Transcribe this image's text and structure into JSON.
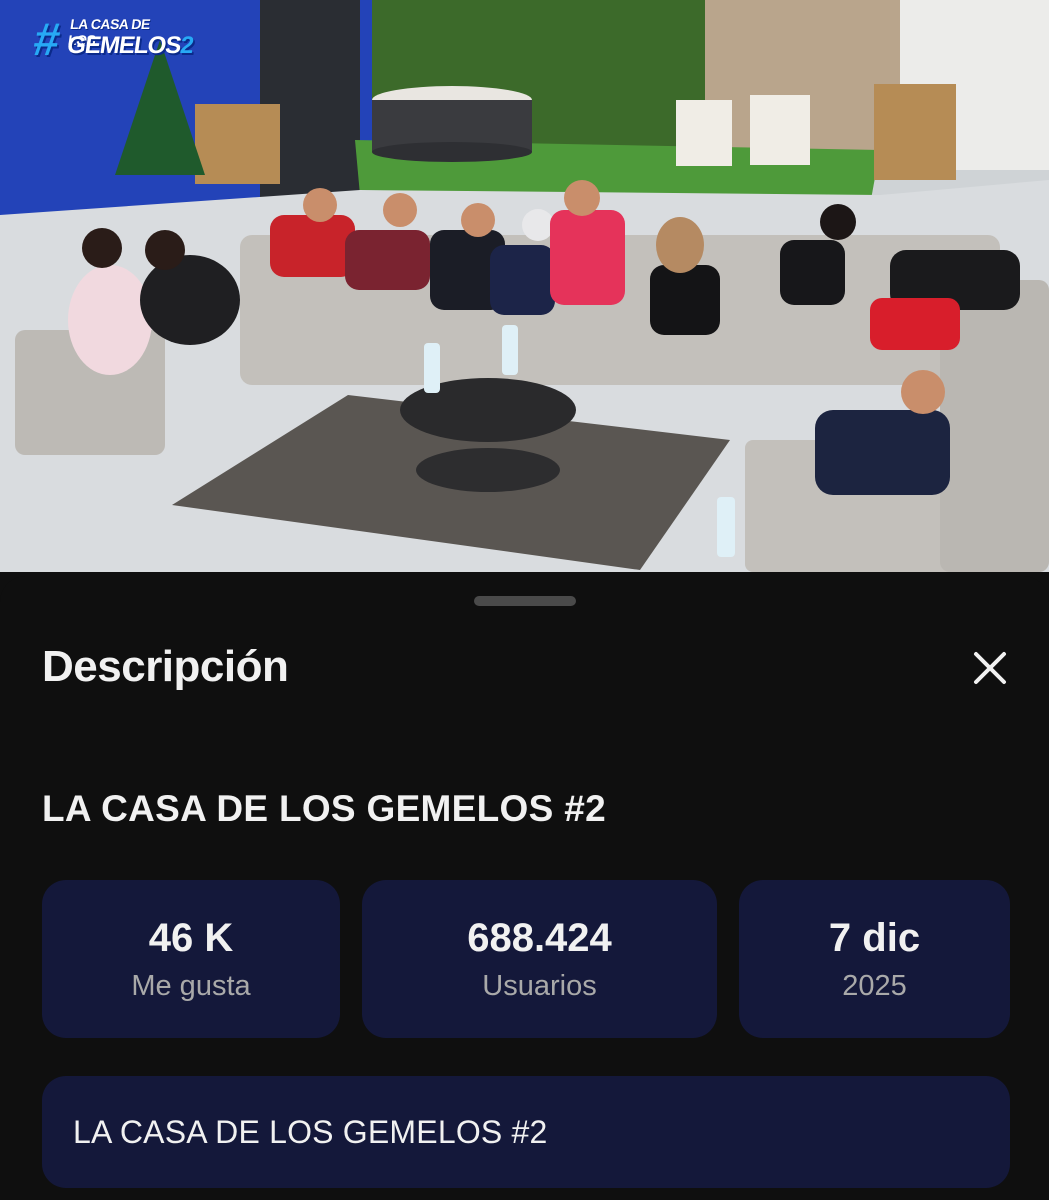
{
  "video": {
    "logo_line1": "LA CASA DE LOS",
    "logo_line2": "GEMELOS",
    "logo_hash": "#",
    "logo_number": "2"
  },
  "sheet": {
    "title": "Descripción",
    "close_icon": "close-icon",
    "video_title": "LA CASA DE LOS GEMELOS #2",
    "stats": {
      "likes": {
        "value": "46 K",
        "label": "Me gusta"
      },
      "views": {
        "value": "688.424",
        "label": "Usuarios"
      },
      "date": {
        "value": "7 dic",
        "label": "2025"
      }
    },
    "description": "LA CASA DE LOS GEMELOS #2"
  },
  "colors": {
    "background": "#0f0f0f",
    "card": "#14183a",
    "text_primary": "#f1f1f1",
    "text_secondary": "#a9a9a9",
    "logo_accent": "#27a9f5"
  }
}
